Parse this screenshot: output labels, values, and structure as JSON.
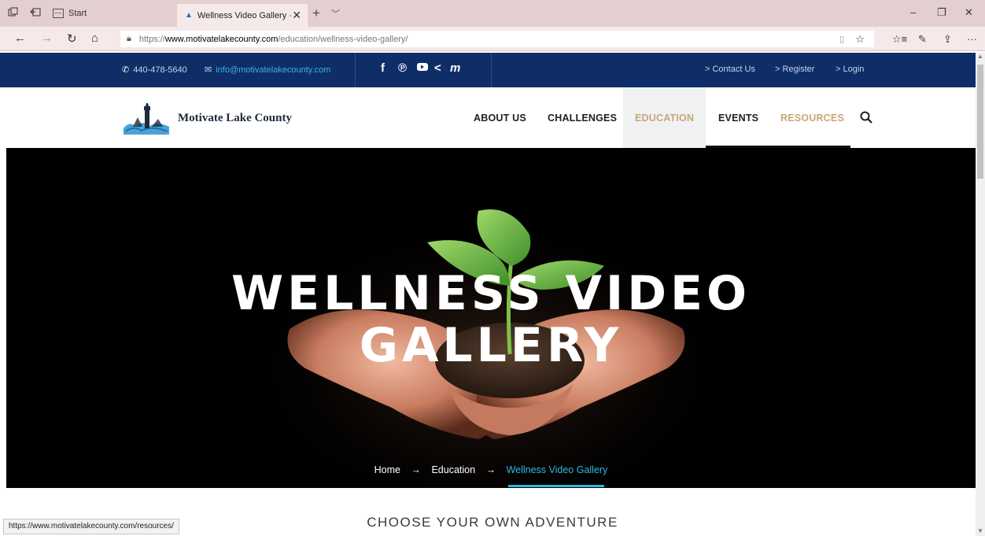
{
  "browser": {
    "start_tab_label": "Start",
    "active_tab_title": "Wellness Video Gallery ·",
    "url_protocol": "https://",
    "url_host": "www.motivatelakecounty.com",
    "url_path": "/education/wellness-video-gallery/",
    "status_url": "https://www.motivatelakecounty.com/resources/"
  },
  "topbar": {
    "phone": "440-478-5640",
    "email": "info@motivatelakecounty.com",
    "social_icons": [
      "facebook-icon",
      "pinterest-icon",
      "youtube-icon",
      "share-icon",
      "meetup-icon"
    ],
    "links": [
      "> Contact Us",
      "> Register",
      "> Login"
    ]
  },
  "header": {
    "brand": "Motivate Lake County",
    "nav": [
      "ABOUT US",
      "CHALLENGES",
      "EDUCATION",
      "EVENTS",
      "RESOURCES"
    ],
    "active_nav": "EDUCATION"
  },
  "hero": {
    "title_line1": "WELLNESS VIDEO",
    "title_line2": "GALLERY",
    "breadcrumb": [
      "Home",
      "Education",
      "Wellness Video Gallery"
    ]
  },
  "content": {
    "section_title": "CHOOSE YOUR OWN ADVENTURE"
  },
  "colors": {
    "topbar_bg": "#0f2e68",
    "accent_gold": "#c8a877",
    "accent_cyan": "#2bb8e0"
  }
}
